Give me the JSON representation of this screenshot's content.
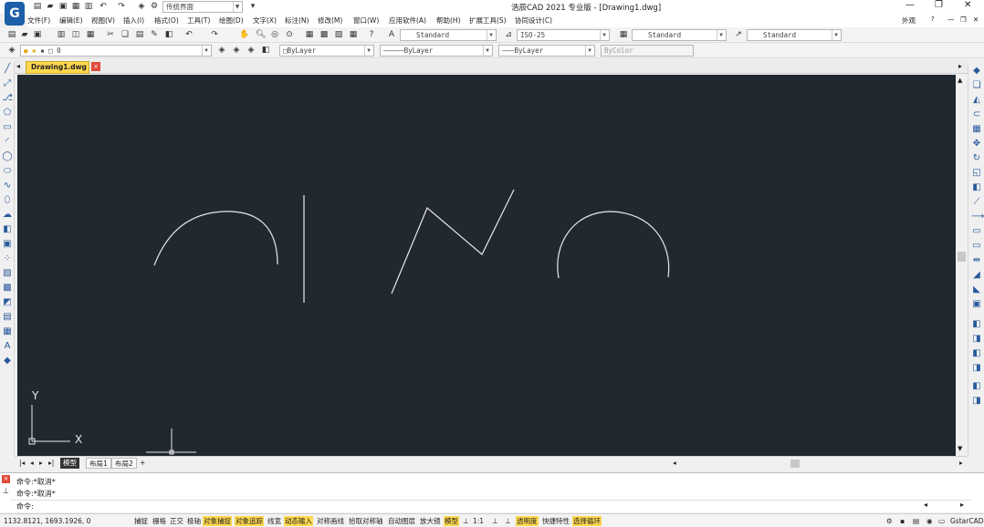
{
  "app": {
    "title": "浩辰CAD 2021 专业版 - [Drawing1.dwg]",
    "workspace": "传统界面",
    "appearance": "外观"
  },
  "menu": [
    "文件(F)",
    "编辑(E)",
    "视图(V)",
    "插入(I)",
    "格式(O)",
    "工具(T)",
    "绘图(D)",
    "文字(X)",
    "标注(N)",
    "修改(M)",
    "窗口(W)",
    "应用软件(A)",
    "帮助(H)",
    "扩展工具(S)",
    "协同设计(C)"
  ],
  "styles": {
    "text_style": "Standard",
    "dim_style": "ISO-25",
    "table_style": "Standard",
    "multileader_style": "Standard"
  },
  "layers": {
    "current_layer": "0",
    "color": "ByLayer",
    "linetype": "ByLayer",
    "lineweight": "ByLayer",
    "plotstyle": "ByColor"
  },
  "document_tab": "Drawing1.dwg",
  "layout_tabs": [
    "模型",
    "布局1",
    "布局2"
  ],
  "ucs": {
    "x_label": "X",
    "y_label": "Y"
  },
  "command_lines": [
    "命令:*取消*",
    "命令:*取消*",
    "命令:"
  ],
  "status": {
    "coordinates": "1132.8121, 1693.1926, 0",
    "buttons": [
      {
        "label": "捕捉",
        "on": false
      },
      {
        "label": "栅格",
        "on": false
      },
      {
        "label": "正交",
        "on": false
      },
      {
        "label": "极轴",
        "on": false
      },
      {
        "label": "对象捕捉",
        "on": true
      },
      {
        "label": "对象追踪",
        "on": true
      },
      {
        "label": "线宽",
        "on": false
      },
      {
        "label": "动态输入",
        "on": true
      },
      {
        "label": "对称画线",
        "on": false
      },
      {
        "label": "拾取对称轴",
        "on": false
      },
      {
        "label": "自动图层",
        "on": false
      },
      {
        "label": "放大镜",
        "on": false
      },
      {
        "label": "模型",
        "on": true
      }
    ],
    "scale": "1:1",
    "transparency": "透明度",
    "quick_props": "快捷特性",
    "select_cycle": "选择循环",
    "brand": "GstarCAD"
  },
  "colors": {
    "canvas": "#212830",
    "accent_yellow": "#ffd84e",
    "icon_blue": "#2a5a9c"
  }
}
